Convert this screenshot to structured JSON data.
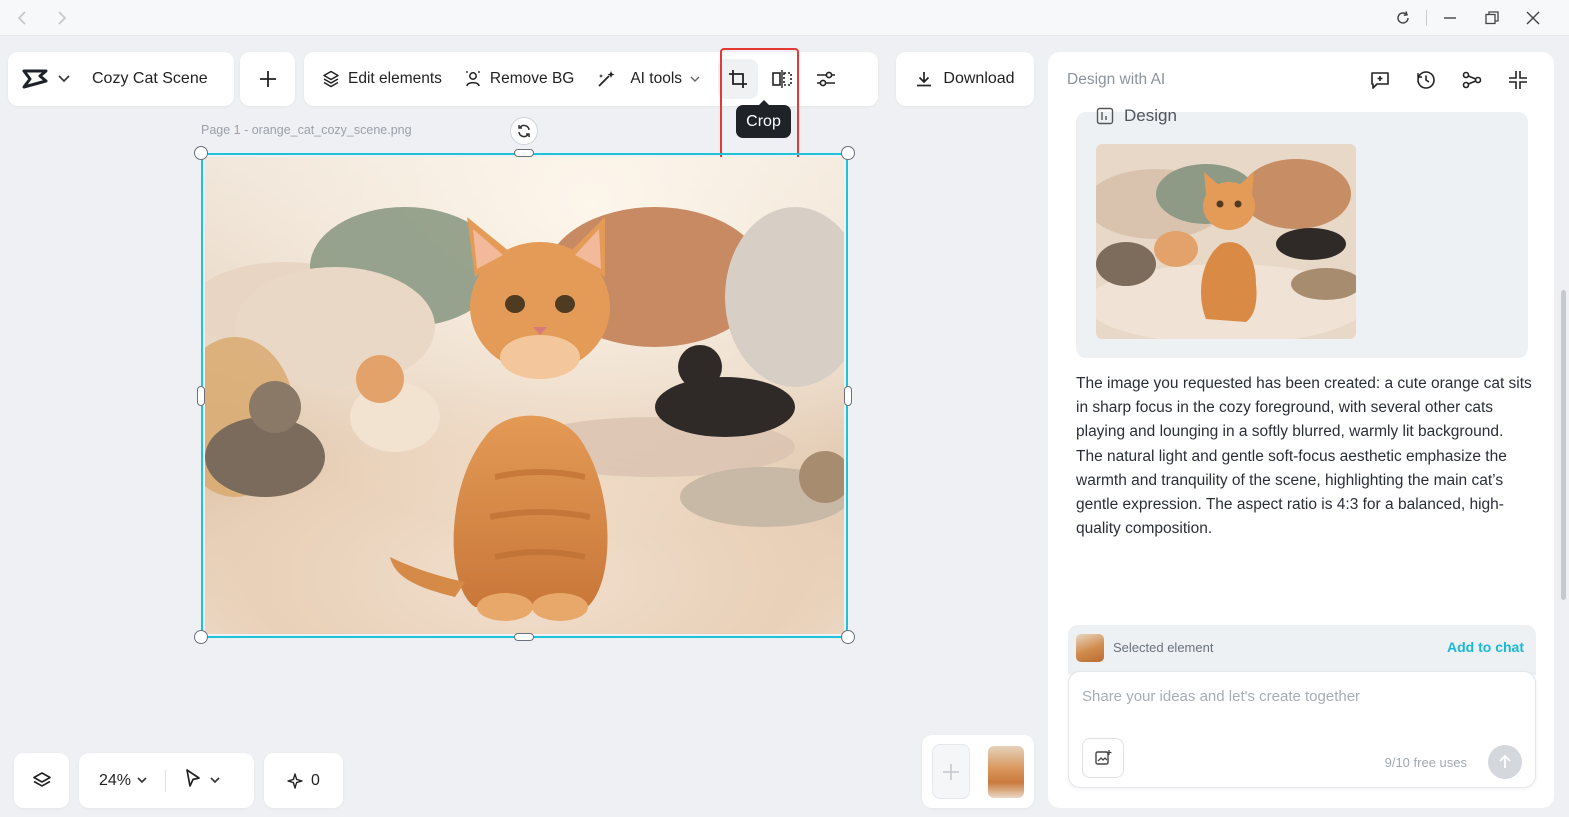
{
  "window": {
    "back_icon": "chevron-left-icon",
    "forward_icon": "chevron-right-icon",
    "controls": [
      "refresh-icon",
      "minimize-icon",
      "restore-icon",
      "close-icon"
    ]
  },
  "header": {
    "project_title": "Cozy Cat Scene",
    "add_label": "+"
  },
  "toolbar": {
    "edit_elements": "Edit elements",
    "remove_bg": "Remove BG",
    "ai_tools": "AI tools",
    "crop_tooltip": "Crop",
    "download": "Download"
  },
  "canvas": {
    "page_label": "Page 1 -  orange_cat_cozy_scene.png",
    "zoom": "24%",
    "sparkle_count": "0"
  },
  "panel": {
    "title": "Design with AI",
    "design_label": "Design",
    "message": "The image you requested has been created: a cute orange cat sits in sharp focus in the cozy foreground, with several other cats playing and lounging in a softly blurred, warmly lit background. The natural light and gentle soft-focus aesthetic emphasize the warmth and tranquility of the scene, highlighting the main cat’s gentle expression. The aspect ratio is 4:3 for a balanced, high-quality composition.",
    "selected_element": "Selected element",
    "add_to_chat": "Add to chat",
    "input_placeholder": "Share your ideas and let's create together",
    "free_uses": "9/10 free uses"
  },
  "colors": {
    "selection": "#1fc3d8",
    "highlight": "#e53935",
    "accent_link": "#18b9d6"
  }
}
